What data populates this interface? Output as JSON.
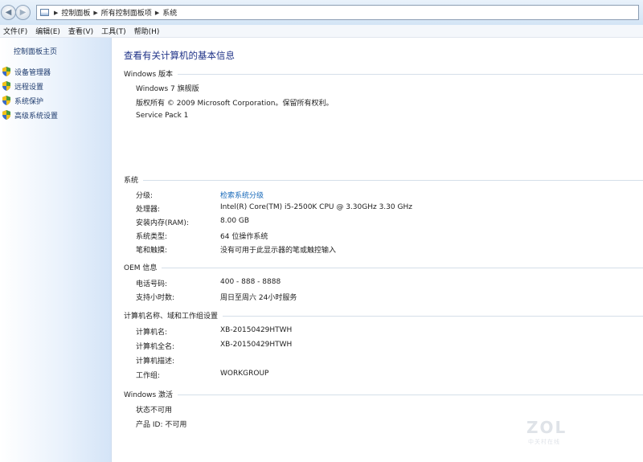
{
  "address_bar": {
    "breadcrumbs": [
      "控制面板",
      "所有控制面板项",
      "系统"
    ]
  },
  "menu": [
    "文件(F)",
    "编辑(E)",
    "查看(V)",
    "工具(T)",
    "帮助(H)"
  ],
  "sidebar": {
    "home": "控制面板主页",
    "items": [
      {
        "label": "设备管理器",
        "icon": "shield-icon"
      },
      {
        "label": "远程设置",
        "icon": "shield-icon"
      },
      {
        "label": "系统保护",
        "icon": "shield-icon"
      },
      {
        "label": "高级系统设置",
        "icon": "shield-icon"
      }
    ]
  },
  "main": {
    "title": "查看有关计算机的基本信息",
    "windows_edition": {
      "heading": "Windows 版本",
      "edition": "Windows 7 旗舰版",
      "copyright": "版权所有 © 2009 Microsoft Corporation。保留所有权利。",
      "service_pack": "Service Pack 1"
    },
    "system": {
      "heading": "系统",
      "rows": [
        {
          "label": "分级:",
          "value": "检索系统分级"
        },
        {
          "label": "处理器:",
          "value": "Intel(R) Core(TM) i5-2500K CPU @ 3.30GHz   3.30 GHz"
        },
        {
          "label": "安装内存(RAM):",
          "value": "8.00 GB"
        },
        {
          "label": "系统类型:",
          "value": "64 位操作系统"
        },
        {
          "label": "笔和触摸:",
          "value": "没有可用于此显示器的笔或触控输入"
        }
      ]
    },
    "oem": {
      "heading": "OEM 信息",
      "rows": [
        {
          "label": "电话号码:",
          "value": "400 - 888 - 8888"
        },
        {
          "label": "支持小时数:",
          "value": "周日至周六  24小时服务"
        }
      ]
    },
    "computer_name": {
      "heading": "计算机名称、域和工作组设置",
      "rows": [
        {
          "label": "计算机名:",
          "value": "XB-20150429HTWH"
        },
        {
          "label": "计算机全名:",
          "value": "XB-20150429HTWH"
        },
        {
          "label": "计算机描述:",
          "value": ""
        },
        {
          "label": "工作组:",
          "value": "WORKGROUP"
        }
      ]
    },
    "activation": {
      "heading": "Windows 激活",
      "status": "状态不可用",
      "product_id": "产品 ID: 不可用"
    }
  },
  "watermark": {
    "logo": "ZOL",
    "sub": "中关村在线"
  },
  "colors": {
    "title": "#1e3287",
    "link": "#1668b9",
    "sidebar_link": "#1e3b6e"
  }
}
